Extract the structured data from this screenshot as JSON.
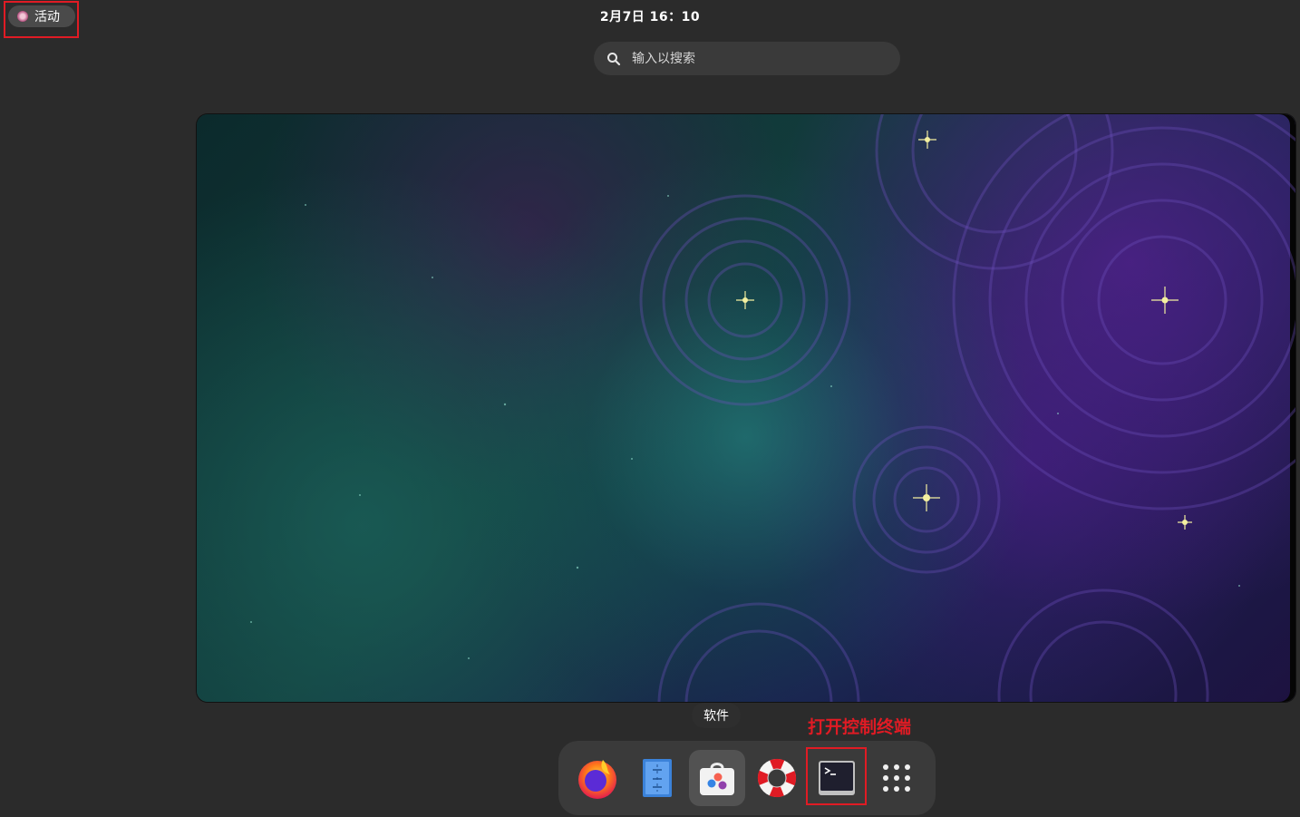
{
  "topbar": {
    "activities_label": "活动",
    "clock": "2月7日 16：10"
  },
  "search": {
    "placeholder": "输入以搜索"
  },
  "dock": {
    "tooltip": "软件",
    "items": [
      {
        "name": "firefox",
        "icon": "firefox-icon"
      },
      {
        "name": "text-editor",
        "icon": "text-editor-icon"
      },
      {
        "name": "software",
        "icon": "software-store-icon"
      },
      {
        "name": "help",
        "icon": "lifebuoy-icon"
      },
      {
        "name": "terminal",
        "icon": "terminal-icon"
      },
      {
        "name": "show-apps",
        "icon": "app-grid-icon"
      }
    ]
  },
  "annotation": {
    "label": "打开控制终端",
    "color": "#e01b24"
  }
}
